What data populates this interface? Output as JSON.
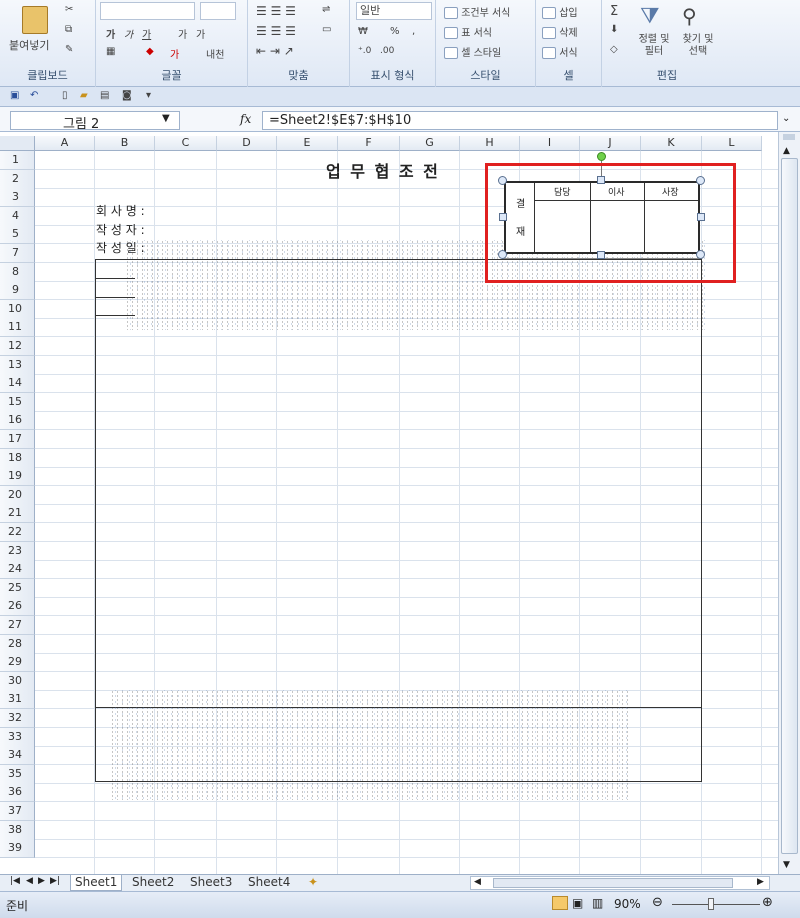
{
  "ribbon": {
    "clipboard": {
      "paste": "붙여넣기",
      "label": "클립보드"
    },
    "font": {
      "bold": "가",
      "italic": "가",
      "underline": "가",
      "grow": "가",
      "shrink": "가",
      "phonetic": "내천",
      "label": "글꼴"
    },
    "alignment": {
      "label": "맞춤"
    },
    "number": {
      "format": "일반",
      "percent": "%",
      "comma": ",",
      "label": "표시 형식"
    },
    "styles": {
      "conditional": "조건부 서식",
      "table": "표 서식",
      "cell": "셀 스타일",
      "label": "스타일"
    },
    "cells": {
      "insert": "삽입",
      "delete": "삭제",
      "format": "서식",
      "label": "셀"
    },
    "editing": {
      "sort": "정렬 및 필터",
      "find": "찾기 및 선택",
      "label": "편집"
    }
  },
  "formula_bar": {
    "name_box": "그림 2",
    "fx": "fx",
    "formula": "=Sheet2!$E$7:$H$10"
  },
  "columns": [
    "A",
    "B",
    "C",
    "D",
    "E",
    "F",
    "G",
    "H",
    "I",
    "J",
    "K",
    "L"
  ],
  "rows": [
    "1",
    "2",
    "3",
    "4",
    "5",
    "7",
    "8",
    "9",
    "10",
    "11",
    "12",
    "13",
    "14",
    "15",
    "16",
    "17",
    "18",
    "19",
    "20",
    "21",
    "22",
    "23",
    "24",
    "25",
    "26",
    "27",
    "28",
    "29",
    "30",
    "31",
    "32",
    "33",
    "34",
    "35",
    "36",
    "37",
    "38",
    "39"
  ],
  "sheet": {
    "title": "업 무 협 조 전",
    "company_label": "회 사 명 :",
    "author_label": "작 성 자 :",
    "date_label": "작 성 일 :"
  },
  "approval": {
    "side_top": "결",
    "side_bottom": "재",
    "headers": [
      "담당",
      "이사",
      "사장"
    ]
  },
  "tabs": [
    "Sheet1",
    "Sheet2",
    "Sheet3",
    "Sheet4"
  ],
  "status": {
    "ready": "준비",
    "zoom": "90%"
  },
  "colors": {
    "highlight": "#e02020",
    "ribbon_bg": "#dfe8f5",
    "grid_line": "#dae2ec"
  }
}
